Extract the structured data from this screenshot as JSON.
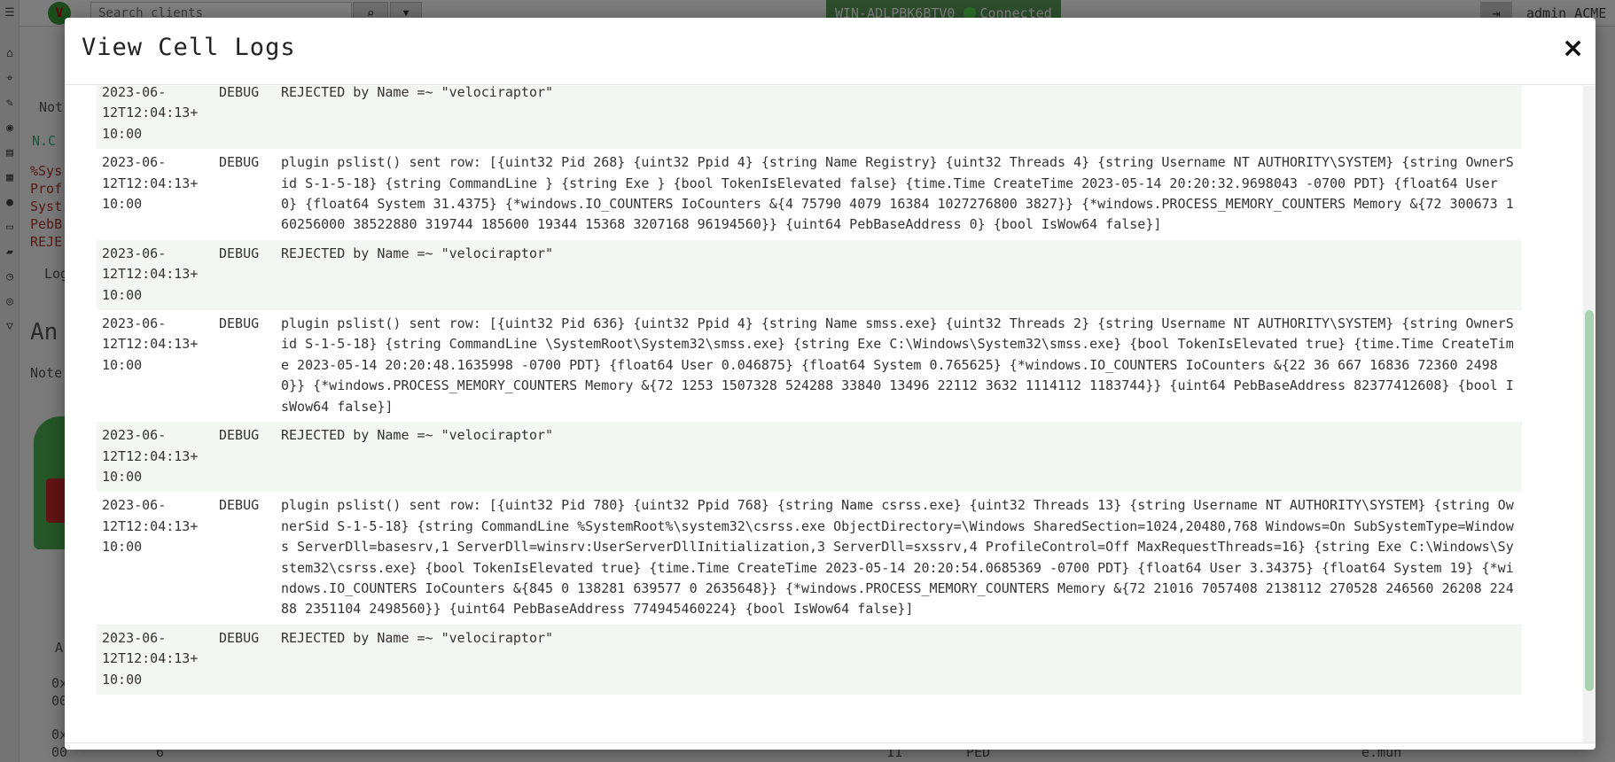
{
  "app": {
    "search_placeholder": "Search clients",
    "client_id": "WIN-ADLPBK6BTV0",
    "connection_status": "Connected",
    "user_label": "admin ACME Inc",
    "background_labels": {
      "notebook_title": "An",
      "note_label": "Note",
      "cell_tab": "Not",
      "nc_label": "N.C",
      "log_btn": "Log",
      "sys_lines": [
        "%Sys",
        "Prof",
        "Syst",
        "PebB",
        "REJE"
      ],
      "col_a": "A",
      "row1": [
        "0x",
        "00"
      ],
      "row2": [
        "0x",
        "00",
        "6",
        "11",
        "PED",
        "e.mun"
      ]
    }
  },
  "modal": {
    "title": "View Cell Logs",
    "close_symbol": "×",
    "logs": [
      {
        "time": "2023-06-\n12T12:04:13+\n10:00",
        "level": "DEBUG",
        "message": "REJECTED by Name =~ \"velociraptor\""
      },
      {
        "time": "2023-06-\n12T12:04:13+\n10:00",
        "level": "DEBUG",
        "message": "plugin pslist() sent row: [{uint32 Pid 268} {uint32 Ppid 4} {string Name Registry} {uint32 Threads 4} {string Username NT AUTHORITY\\SYSTEM} {string OwnerSid S-1-5-18} {string CommandLine } {string Exe } {bool TokenIsElevated false} {time.Time CreateTime 2023-05-14 20:20:32.9698043 -0700 PDT} {float64 User 0} {float64 System 31.4375} {*windows.IO_COUNTERS IoCounters &{4 75790 4079 16384 1027276800 3827}} {*windows.PROCESS_MEMORY_COUNTERS Memory &{72 300673 160256000 38522880 319744 185600 19344 15368 3207168 96194560}} {uint64 PebBaseAddress 0} {bool IsWow64 false}]"
      },
      {
        "time": "2023-06-\n12T12:04:13+\n10:00",
        "level": "DEBUG",
        "message": "REJECTED by Name =~ \"velociraptor\""
      },
      {
        "time": "2023-06-\n12T12:04:13+\n10:00",
        "level": "DEBUG",
        "message": "plugin pslist() sent row: [{uint32 Pid 636} {uint32 Ppid 4} {string Name smss.exe} {uint32 Threads 2} {string Username NT AUTHORITY\\SYSTEM} {string OwnerSid S-1-5-18} {string CommandLine \\SystemRoot\\System32\\smss.exe} {string Exe C:\\Windows\\System32\\smss.exe} {bool TokenIsElevated true} {time.Time CreateTime 2023-05-14 20:20:48.1635998 -0700 PDT} {float64 User 0.046875} {float64 System 0.765625} {*windows.IO_COUNTERS IoCounters &{22 36 667 16836 72360 24980}} {*windows.PROCESS_MEMORY_COUNTERS Memory &{72 1253 1507328 524288 33840 13496 22112 3632 1114112 1183744}} {uint64 PebBaseAddress 82377412608} {bool IsWow64 false}]"
      },
      {
        "time": "2023-06-\n12T12:04:13+\n10:00",
        "level": "DEBUG",
        "message": "REJECTED by Name =~ \"velociraptor\""
      },
      {
        "time": "2023-06-\n12T12:04:13+\n10:00",
        "level": "DEBUG",
        "message": "plugin pslist() sent row: [{uint32 Pid 780} {uint32 Ppid 768} {string Name csrss.exe} {uint32 Threads 13} {string Username NT AUTHORITY\\SYSTEM} {string OwnerSid S-1-5-18} {string CommandLine %SystemRoot%\\system32\\csrss.exe ObjectDirectory=\\Windows SharedSection=1024,20480,768 Windows=On SubSystemType=Windows ServerDll=basesrv,1 ServerDll=winsrv:UserServerDllInitialization,3 ServerDll=sxssrv,4 ProfileControl=Off MaxRequestThreads=16} {string Exe C:\\Windows\\System32\\csrss.exe} {bool TokenIsElevated true} {time.Time CreateTime 2023-05-14 20:20:54.0685369 -0700 PDT} {float64 User 3.34375} {float64 System 19} {*windows.IO_COUNTERS IoCounters &{845 0 138281 639577 0 2635648}} {*windows.PROCESS_MEMORY_COUNTERS Memory &{72 21016 7057408 2138112 270528 246560 26208 22488 2351104 2498560}} {uint64 PebBaseAddress 774945460224} {bool IsWow64 false}]"
      },
      {
        "time": "2023-06-\n12T12:04:13+\n10:00",
        "level": "DEBUG",
        "message": "REJECTED by Name =~ \"velociraptor\""
      }
    ]
  }
}
